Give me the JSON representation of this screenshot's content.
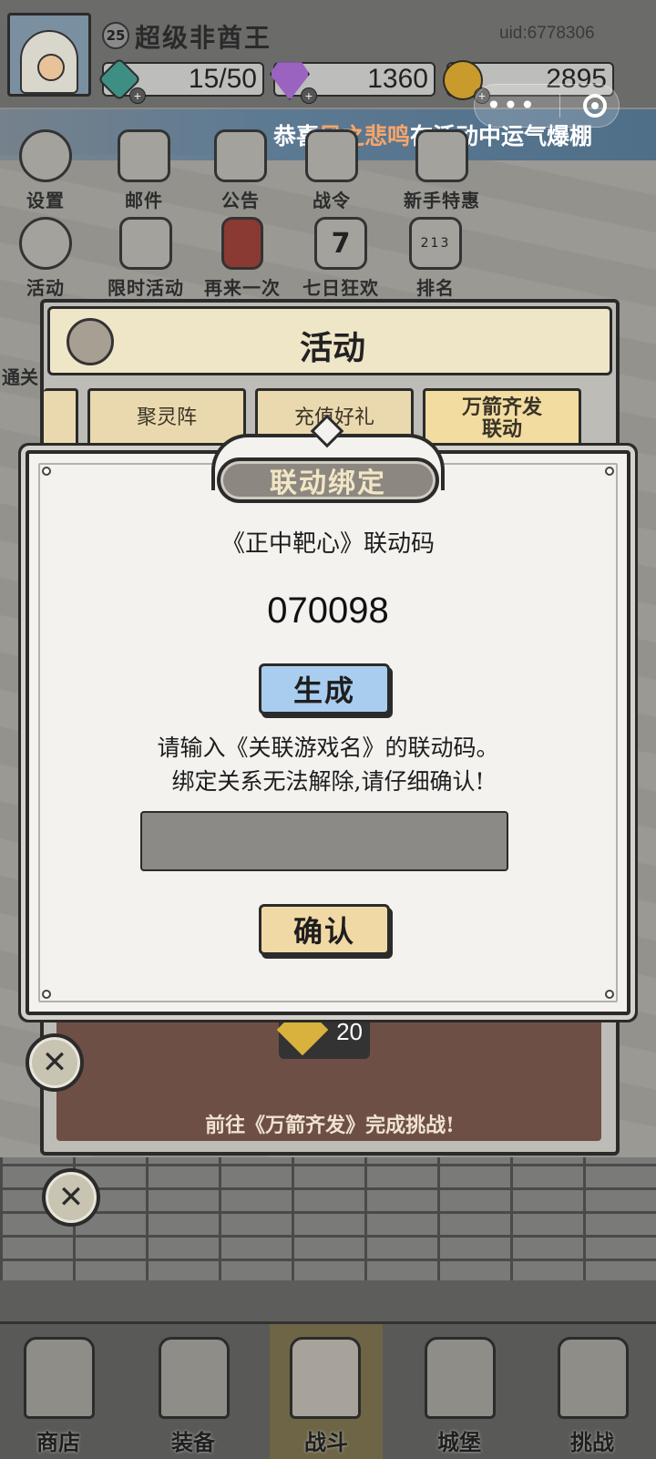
{
  "player": {
    "level": "25",
    "name": "超级非酋王",
    "uid": "uid:6778306"
  },
  "resources": {
    "stamina": "15/50",
    "gems": "1360",
    "coins": "2895",
    "plus_label": "+"
  },
  "banner": {
    "prefix": "恭喜",
    "highlight": "风之悲鸣",
    "suffix": "在活动中运气爆棚"
  },
  "menu_row1": [
    {
      "label": "设置",
      "icon": "gear-icon"
    },
    {
      "label": "邮件",
      "icon": "mail-icon"
    },
    {
      "label": "公告",
      "icon": "notice-icon"
    },
    {
      "label": "战令",
      "icon": "battle-pass-icon"
    },
    {
      "label": "新手特惠",
      "icon": "newbie-deal-icon"
    }
  ],
  "menu_row2": [
    {
      "label": "活动",
      "icon": "laurel-icon"
    },
    {
      "label": "限时活动",
      "icon": "hourglass-icon"
    },
    {
      "label": "再来一次",
      "icon": "card-icon"
    },
    {
      "label": "七日狂欢",
      "icon": "seven-day-badge-icon",
      "badge": "7"
    },
    {
      "label": "排名",
      "icon": "podium-icon",
      "podium": "213"
    }
  ],
  "side_label": "通关",
  "activity_panel": {
    "title": "活动",
    "tabs": [
      {
        "label": "聚灵阵",
        "active": false
      },
      {
        "label": "充值好礼",
        "active": false
      },
      {
        "label": "万箭齐发\n联动",
        "active": true
      }
    ],
    "reward_count": "20",
    "hint": "前往《万箭齐发》完成挑战!"
  },
  "modal": {
    "title": "联动绑定",
    "code_label": "《正中靶心》联动码",
    "code_value": "070098",
    "generate_label": "生成",
    "instruction_line1": "请输入《关联游戏名》的联动码。",
    "instruction_line2": "绑定关系无法解除,请仔细确认!",
    "input_value": "",
    "input_placeholder": "",
    "confirm_label": "确认"
  },
  "close_symbol": "✕",
  "bottom_nav": [
    {
      "label": "商店",
      "icon": "shop-icon",
      "active": false
    },
    {
      "label": "装备",
      "icon": "backpack-icon",
      "active": false
    },
    {
      "label": "战斗",
      "icon": "crossed-swords-icon",
      "active": true
    },
    {
      "label": "城堡",
      "icon": "castle-icon",
      "active": false
    },
    {
      "label": "挑战",
      "icon": "shield-icon",
      "active": false
    }
  ],
  "colors": {
    "banner_highlight": "#f6a56b",
    "generate_button": "#a9cdef",
    "confirm_button": "#f1d9a6"
  }
}
